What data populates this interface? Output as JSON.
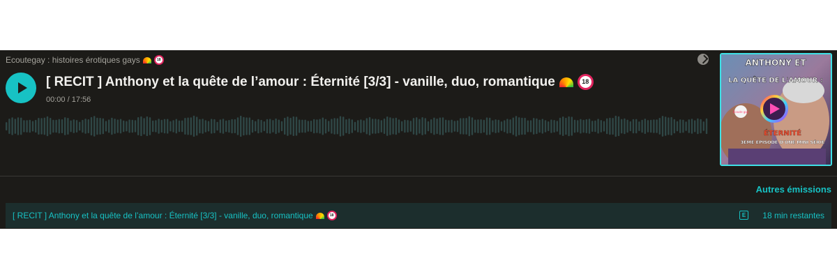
{
  "player": {
    "show_title": "Ecoutegay : histoires érotiques gays",
    "episode_title": "[ RECIT ] Anthony et la quête de l’amour : Éternité [3/3] - vanille, duo, romantique",
    "time_current": "00:00",
    "time_separator": " / ",
    "time_total": "17:56",
    "badge_18": "18",
    "icons": {
      "play": "play-icon",
      "share": "share-icon",
      "rainbow": "rainbow-emoji",
      "no_under_18": "no-under-18-emoji"
    },
    "progress": 0
  },
  "cover": {
    "line1": "ANTHONY ET",
    "line2": "LA QUÊTE DE L'AMOUR :",
    "line3": "ÉTERNITÉ",
    "line4": "3EME EPISODE D'UNE MINI SÉRIE",
    "logo_text": "Ecoute gay"
  },
  "other_shows": {
    "label": "Autres émissions"
  },
  "episode_list": [
    {
      "title": "[ RECIT ] Anthony et la quête de l’amour : Éternité [3/3] - vanille, duo, romantique",
      "explicit_badge": "E",
      "remaining": "18 min restantes"
    }
  ],
  "colors": {
    "accent": "#17c2c4",
    "background": "#1c1b18",
    "row_background": "#1c2e2d",
    "waveform": "#2f4746"
  }
}
